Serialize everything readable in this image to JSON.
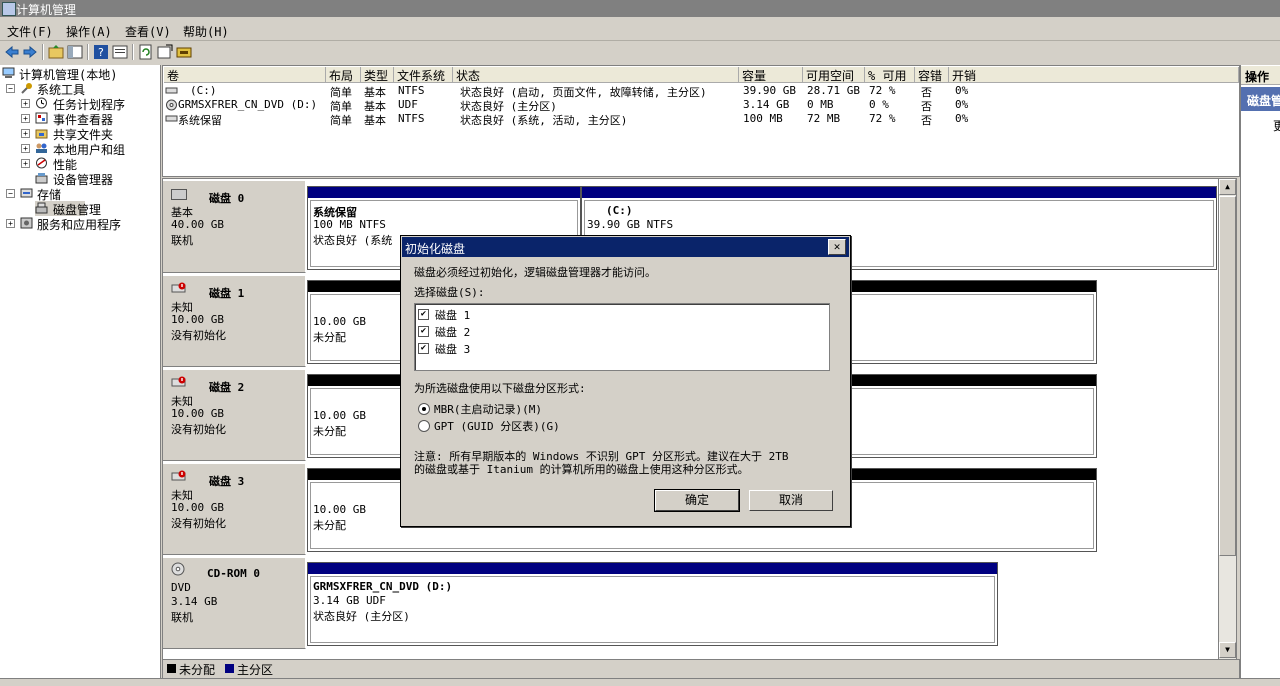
{
  "window": {
    "title": "计算机管理"
  },
  "menu": [
    "文件(F)",
    "操作(A)",
    "查看(V)",
    "帮助(H)"
  ],
  "tree": {
    "root": "计算机管理(本地)",
    "system_tools": "系统工具",
    "task_scheduler": "任务计划程序",
    "event_viewer": "事件查看器",
    "shared_folders": "共享文件夹",
    "local_users": "本地用户和组",
    "performance": "性能",
    "device_manager": "设备管理器",
    "storage": "存储",
    "disk_management": "磁盘管理",
    "services": "服务和应用程序"
  },
  "volume_table": {
    "columns": [
      "卷",
      "布局",
      "类型",
      "文件系统",
      "状态",
      "容量",
      "可用空间",
      "% 可用",
      "容错",
      "开销"
    ],
    "rows": [
      [
        "(C:)",
        "简单",
        "基本",
        "NTFS",
        "状态良好 (启动, 页面文件, 故障转储, 主分区)",
        "39.90 GB",
        "28.71 GB",
        "72 %",
        "否",
        "0%"
      ],
      [
        "GRMSXFRER_CN_DVD (D:)",
        "简单",
        "基本",
        "UDF",
        "状态良好 (主分区)",
        "3.14 GB",
        "0 MB",
        "0 %",
        "否",
        "0%"
      ],
      [
        "系统保留",
        "简单",
        "基本",
        "NTFS",
        "状态良好 (系统, 活动, 主分区)",
        "100 MB",
        "72 MB",
        "72 %",
        "否",
        "0%"
      ]
    ]
  },
  "disks": [
    {
      "name": "磁盘 0",
      "l1": "基本",
      "l2": "40.00 GB",
      "l3": "联机"
    },
    {
      "name": "磁盘 1",
      "l1": "未知",
      "l2": "10.00 GB",
      "l3": "没有初始化"
    },
    {
      "name": "磁盘 2",
      "l1": "未知",
      "l2": "10.00 GB",
      "l3": "没有初始化"
    },
    {
      "name": "磁盘 3",
      "l1": "未知",
      "l2": "10.00 GB",
      "l3": "没有初始化"
    },
    {
      "name": "CD-ROM 0",
      "l1": "DVD",
      "l2": "3.14 GB",
      "l3": "联机"
    }
  ],
  "partitions": {
    "sysres": {
      "name": "系统保留",
      "size": "100 MB NTFS",
      "status": "状态良好 (系统"
    },
    "c": {
      "name": "(C:)",
      "size": "39.90 GB NTFS",
      "status_tail": ")"
    },
    "d1": {
      "size": "10.00 GB",
      "status": "未分配"
    },
    "d2": {
      "size": "10.00 GB",
      "status": "未分配"
    },
    "d3": {
      "size": "10.00 GB",
      "status": "未分配"
    },
    "dvd": {
      "name": "GRMSXFRER_CN_DVD  (D:)",
      "size": "3.14 GB UDF",
      "status": "状态良好 (主分区)"
    }
  },
  "legend": {
    "unalloc": "未分配",
    "primary": "主分区"
  },
  "action_pane": {
    "title": "操作",
    "section": "磁盘管",
    "more": "更"
  },
  "dialog": {
    "title": "初始化磁盘",
    "intro": "磁盘必须经过初始化，逻辑磁盘管理器才能访问。",
    "select_label": "选择磁盘(S):",
    "disks": [
      "磁盘 1",
      "磁盘 2",
      "磁盘 3"
    ],
    "style_label": "为所选磁盘使用以下磁盘分区形式:",
    "mbr": "MBR(主启动记录)(M)",
    "gpt": "GPT (GUID 分区表)(G)",
    "note1": "注意: 所有早期版本的 Windows 不识别 GPT 分区形式。建议在大于 2TB",
    "note2": "的磁盘或基于 Itanium 的计算机所用的磁盘上使用这种分区形式。",
    "ok": "确定",
    "cancel": "取消"
  },
  "colors": {
    "primary_partition": "#000080",
    "unallocated": "#000000",
    "title_active": "#0a246a"
  }
}
